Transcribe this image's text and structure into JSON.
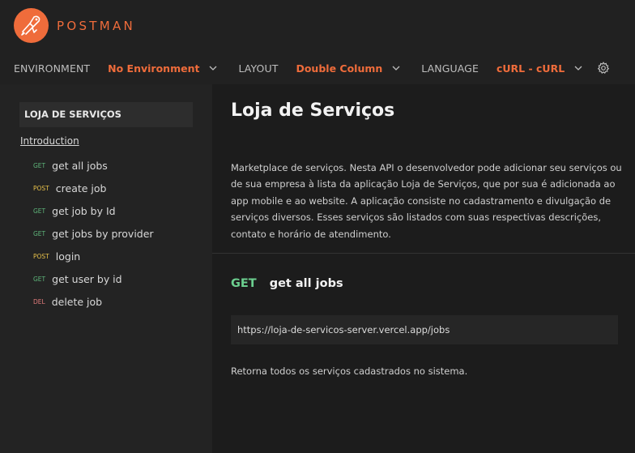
{
  "header": {
    "logo_text": "POSTMAN",
    "settings": [
      {
        "label": "ENVIRONMENT",
        "value": "No Environment"
      },
      {
        "label": "LAYOUT",
        "value": "Double Column"
      },
      {
        "label": "LANGUAGE",
        "value": "cURL - cURL"
      }
    ]
  },
  "sidebar": {
    "title": "LOJA DE SERVIÇOS",
    "intro": "Introduction",
    "items": [
      {
        "method": "GET",
        "label": "get all jobs"
      },
      {
        "method": "POST",
        "label": "create job"
      },
      {
        "method": "GET",
        "label": "get job by Id"
      },
      {
        "method": "GET",
        "label": "get jobs by provider"
      },
      {
        "method": "POST",
        "label": "login"
      },
      {
        "method": "GET",
        "label": "get user by id"
      },
      {
        "method": "DEL",
        "label": "delete job"
      }
    ]
  },
  "main": {
    "title": "Loja de Serviços",
    "description": "Marketplace de serviços. Nesta API o desenvolvedor pode adicionar seu serviços ou de sua empresa à lista da aplicação Loja de Serviços, que por sua é adicionada ao app mobile e ao website. A aplicação consiste no cadastramento e divulgação de serviços diversos. Esses serviços são listados com suas respectivas descrições, contato e horário de atendimento.",
    "request": {
      "method": "GET",
      "name": "get all jobs",
      "url": "https://loja-de-servicos-server.vercel.app/jobs",
      "description": "Retorna todos os serviços cadastrados no sistema."
    }
  },
  "colors": {
    "accent": "#ef6c3b",
    "get": "#5fb67b",
    "post": "#e7c049",
    "del": "#e07a7a",
    "background": "#1c1c1c"
  },
  "icons": [
    "postman-logo-icon",
    "chevron-down-icon",
    "gear-icon"
  ]
}
